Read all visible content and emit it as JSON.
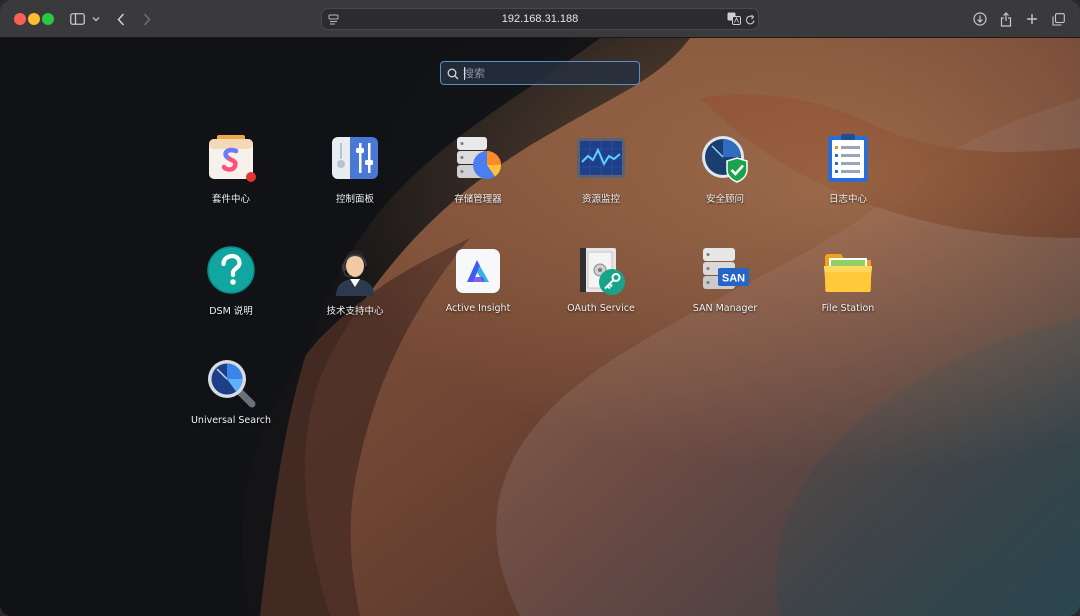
{
  "browser": {
    "url": "192.168.31.188"
  },
  "search": {
    "placeholder": "搜索",
    "value": ""
  },
  "apps": [
    {
      "label": "套件中心",
      "icon": "package-center-icon"
    },
    {
      "label": "控制面板",
      "icon": "control-panel-icon"
    },
    {
      "label": "存储管理器",
      "icon": "storage-manager-icon"
    },
    {
      "label": "资源监控",
      "icon": "resource-monitor-icon"
    },
    {
      "label": "安全顾问",
      "icon": "security-advisor-icon"
    },
    {
      "label": "日志中心",
      "icon": "log-center-icon"
    },
    {
      "label": "DSM 说明",
      "icon": "help-icon"
    },
    {
      "label": "技术支持中心",
      "icon": "support-center-icon"
    },
    {
      "label": "Active Insight",
      "icon": "active-insight-icon"
    },
    {
      "label": "OAuth Service",
      "icon": "oauth-service-icon"
    },
    {
      "label": "SAN Manager",
      "icon": "san-manager-icon"
    },
    {
      "label": "File Station",
      "icon": "file-station-icon"
    },
    {
      "label": "Universal Search",
      "icon": "universal-search-icon"
    }
  ],
  "san_badge": "SAN"
}
